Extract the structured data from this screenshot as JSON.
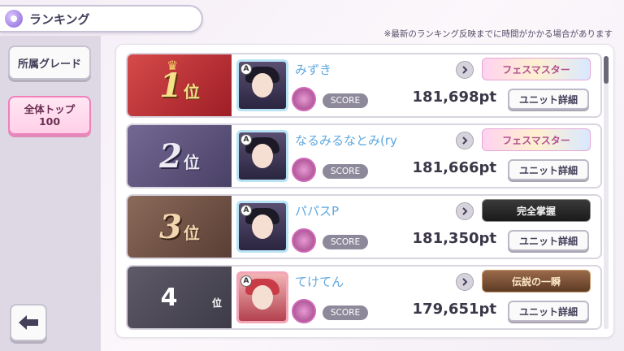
{
  "header": {
    "title": "ランキング"
  },
  "notice": "※最新のランキング反映までに時間がかかる場合があります",
  "sidebar": {
    "grade_label": "所属グレード",
    "top_label_line1": "全体トップ",
    "top_label_line2": "100"
  },
  "score_label": "SCORE",
  "detail_label": "ユニット詳細",
  "rows": [
    {
      "rank": "1",
      "rank_suffix": "位",
      "name": "みずき",
      "score": "181,698pt",
      "title_badge": "フェスマスター"
    },
    {
      "rank": "2",
      "rank_suffix": "位",
      "name": "なるみるなとみ(ry",
      "score": "181,666pt",
      "title_badge": "フェスマスター"
    },
    {
      "rank": "3",
      "rank_suffix": "位",
      "name": "パパスP",
      "score": "181,350pt",
      "title_badge": "完全掌握"
    },
    {
      "rank": "4",
      "rank_suffix": "位",
      "name": "てけてん",
      "score": "179,651pt",
      "title_badge": "伝説の一瞬"
    }
  ],
  "colors": {
    "accent_pink": "#f07fba",
    "name_blue": "#5fa8e0"
  }
}
